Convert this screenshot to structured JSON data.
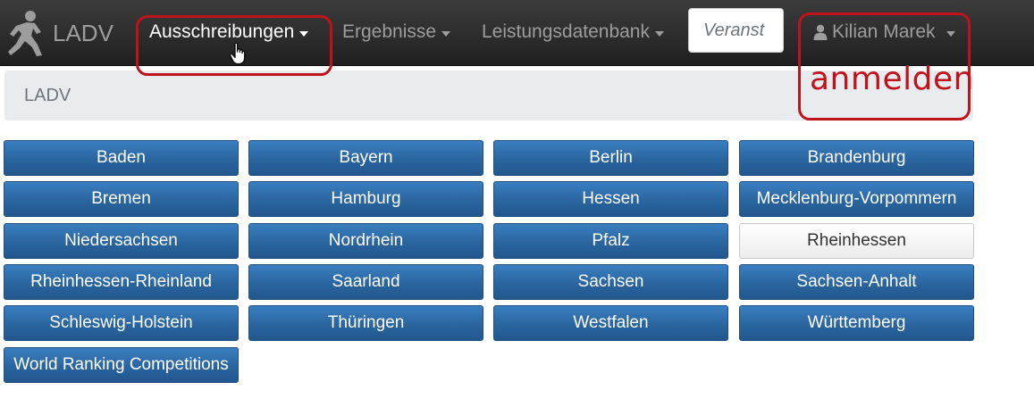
{
  "navbar": {
    "brand": "LADV",
    "menu": [
      {
        "label": "Ausschreibungen"
      },
      {
        "label": "Ergebnisse"
      },
      {
        "label": "Leistungsdatenbank"
      }
    ],
    "search": {
      "placeholder": "Veranst"
    },
    "user": {
      "name": "Kilian Marek"
    }
  },
  "annotation": {
    "label": "anmelden",
    "color": "#c0121a"
  },
  "breadcrumb": {
    "text": "LADV"
  },
  "regions": [
    "Baden",
    "Bayern",
    "Berlin",
    "Brandenburg",
    "Bremen",
    "Hamburg",
    "Hessen",
    "Mecklenburg-Vorpommern",
    "Niedersachsen",
    "Nordrhein",
    "Pfalz",
    "Rheinhessen",
    "Rheinhessen-Rheinland",
    "Saarland",
    "Sachsen",
    "Sachsen-Anhalt",
    "Schleswig-Holstein",
    "Thüringen",
    "Westfalen",
    "Württemberg",
    "World Ranking Competitions"
  ],
  "selected_region": "Rheinhessen",
  "colors": {
    "navbar": "#2b2b2b",
    "button_primary": "#2a659f",
    "button_selected": "#f5f5f5",
    "breadcrumb_bg": "#e9ecef"
  }
}
